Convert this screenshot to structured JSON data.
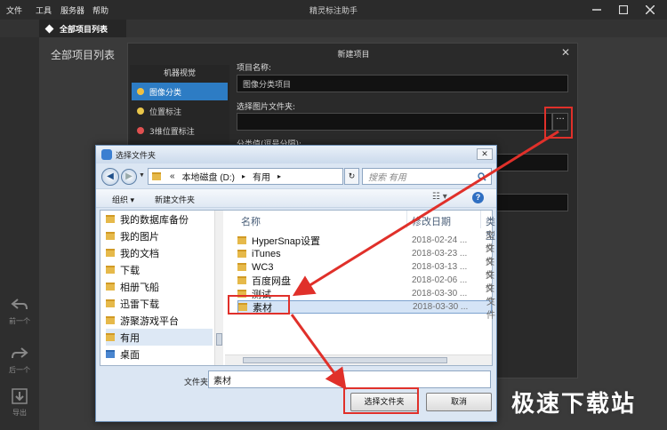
{
  "menu": [
    "文件",
    "工具",
    "服务器",
    "帮助"
  ],
  "app_title": "精灵标注助手",
  "tab_label": "全部项目列表",
  "project_list_title": "全部项目列表",
  "rail": {
    "back": "前一个",
    "forward": "后一个",
    "export": "导出"
  },
  "new_project": {
    "title": "新建项目",
    "side_heading": "机器视觉",
    "side_items": [
      "图像分类",
      "位置标注",
      "3维位置标注"
    ],
    "label_name": "项目名称:",
    "name_value": "图像分类项目",
    "label_folder": "选择图片文件夹:",
    "folder_value": "",
    "label_classes": "分类值(逗号分隔):",
    "browse": "···"
  },
  "folder_dialog": {
    "title": "选择文件夹",
    "address": [
      "«",
      "本地磁盘 (D:)",
      "▸",
      "有用",
      "▸"
    ],
    "search_placeholder": "搜索 有用",
    "organize": "组织 ▾",
    "new_folder": "新建文件夹",
    "tree": [
      "我的数据库备份",
      "我的图片",
      "我的文档",
      "下载",
      "相册飞船",
      "迅雷下载",
      "游聚游戏平台",
      "有用",
      "桌面"
    ],
    "tree_selected": "有用",
    "columns": {
      "name": "名称",
      "date": "修改日期",
      "type": "类型"
    },
    "rows": [
      {
        "name": "HyperSnap设置",
        "date": "2018-02-24 ...",
        "type": "文件"
      },
      {
        "name": "iTunes",
        "date": "2018-03-23 ...",
        "type": "文件"
      },
      {
        "name": "WC3",
        "date": "2018-03-13 ...",
        "type": "文件"
      },
      {
        "name": "百度网盘",
        "date": "2018-02-06 ...",
        "type": "文件"
      },
      {
        "name": "测试",
        "date": "2018-03-30 ...",
        "type": "文件"
      },
      {
        "name": "素材",
        "date": "2018-03-30 ...",
        "type": "文件"
      }
    ],
    "filename_label": "文件夹:",
    "filename_value": "素材",
    "select_button": "选择文件夹",
    "cancel_button": "取消"
  },
  "watermark": "极速下载站",
  "colors": {
    "accent": "#2d7cc4",
    "annotation": "#e0302a"
  }
}
